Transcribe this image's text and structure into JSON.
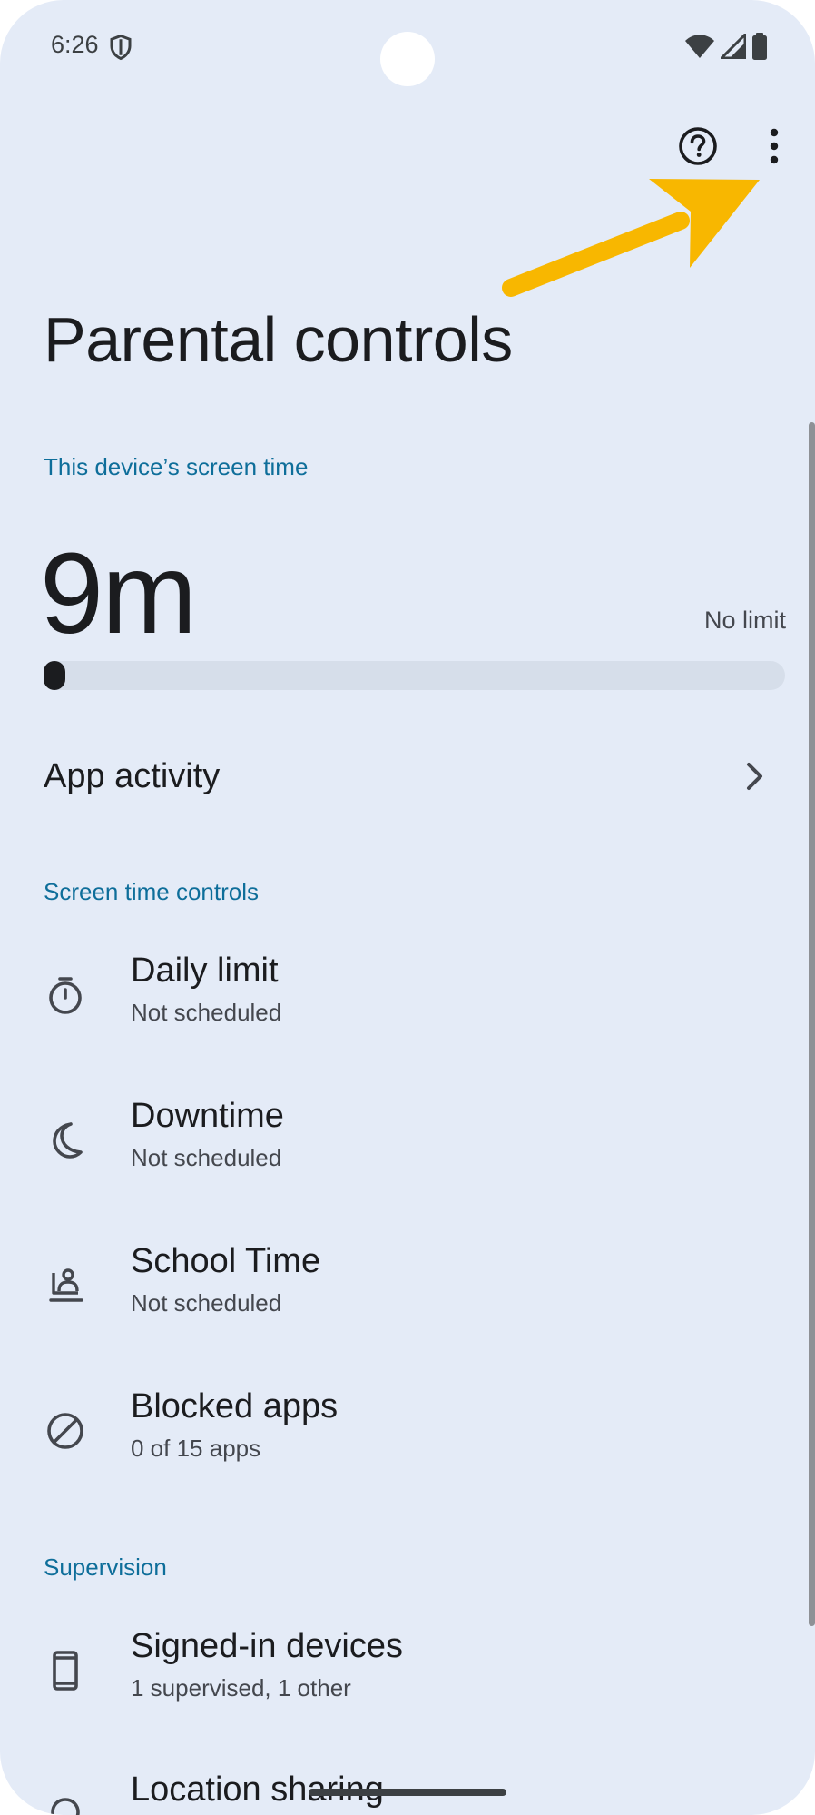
{
  "status_bar": {
    "time": "6:26",
    "icons": [
      "shield-icon",
      "wifi-icon",
      "cell-signal-icon",
      "battery-icon"
    ]
  },
  "top_bar": {
    "actions": [
      "help-icon",
      "more-vertical-icon"
    ],
    "annotation": "arrow-pointer-icon"
  },
  "page": {
    "title": "Parental controls"
  },
  "screen_time": {
    "header": "This device’s screen time",
    "value": "9m",
    "limit": "No limit",
    "progress_fraction": 0.02
  },
  "app_activity": {
    "label": "App activity",
    "icon": "chevron-right-icon"
  },
  "controls": {
    "header": "Screen time controls",
    "items": [
      {
        "icon": "timer-icon",
        "title": "Daily limit",
        "subtitle": "Not scheduled"
      },
      {
        "icon": "moon-icon",
        "title": "Downtime",
        "subtitle": "Not scheduled"
      },
      {
        "icon": "school-desk-icon",
        "title": "School Time",
        "subtitle": "Not scheduled"
      },
      {
        "icon": "block-icon",
        "title": "Blocked apps",
        "subtitle": "0 of 15 apps"
      }
    ]
  },
  "supervision": {
    "header": "Supervision",
    "items": [
      {
        "icon": "phone-icon",
        "title": "Signed-in devices",
        "subtitle": "1 supervised, 1 other"
      },
      {
        "icon": "location-icon",
        "title": "Location sharing",
        "subtitle": ""
      }
    ]
  },
  "colors": {
    "background": "#e4ebf7",
    "accent": "#0e6e9a",
    "text_primary": "#1b1c1f",
    "text_secondary": "#44474e",
    "annotation_arrow": "#f8b700"
  }
}
